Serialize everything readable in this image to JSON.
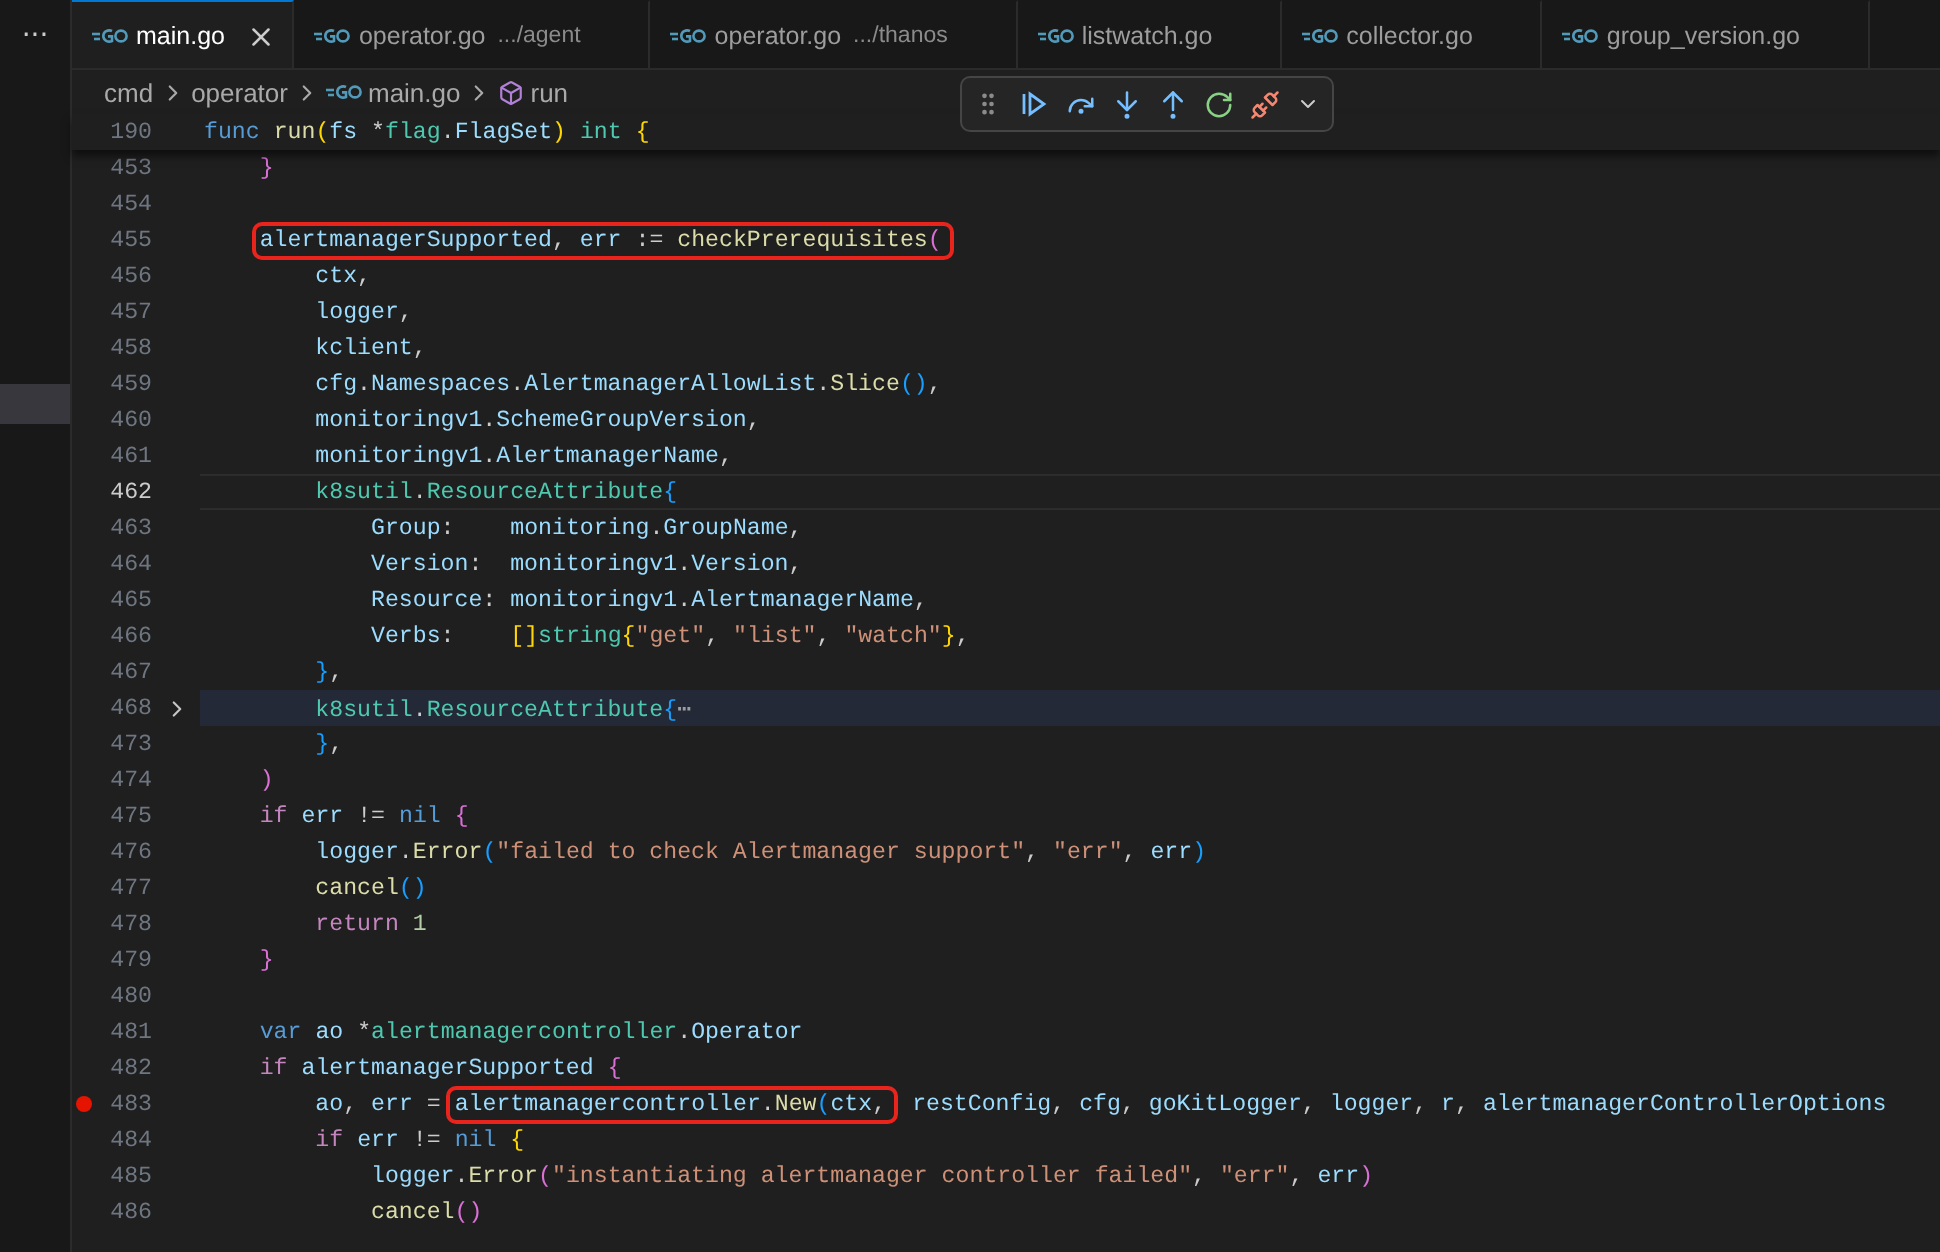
{
  "more_button": "···",
  "tabs": [
    {
      "label": "main.go",
      "selected": true
    },
    {
      "label": "operator.go",
      "detail": ".../agent",
      "selected": false
    },
    {
      "label": "operator.go",
      "detail": ".../thanos",
      "selected": false
    },
    {
      "label": "listwatch.go",
      "selected": false
    },
    {
      "label": "collector.go",
      "selected": false
    },
    {
      "label": "group_version.go",
      "selected": false
    }
  ],
  "breadcrumb": [
    {
      "label": "cmd",
      "kind": "folder"
    },
    {
      "label": "operator",
      "kind": "folder"
    },
    {
      "label": "main.go",
      "kind": "file"
    },
    {
      "label": "run",
      "kind": "symbol"
    }
  ],
  "sticky_line": {
    "number": "190",
    "code": "func run(fs *flag.FlagSet) int {"
  },
  "lines": [
    {
      "number": "453",
      "current": false,
      "breakpoint": false,
      "folded": false,
      "code": "    }"
    },
    {
      "number": "454",
      "current": false,
      "breakpoint": false,
      "folded": false
    },
    {
      "number": "455",
      "current": false,
      "breakpoint": false,
      "folded": false,
      "segments": [
        {
          "text": "    alertmanagerSupported, err := checkPrerequisites(",
          "boxed": true
        }
      ]
    },
    {
      "number": "456",
      "current": false,
      "breakpoint": false,
      "folded": false,
      "code": "        ctx,"
    },
    {
      "number": "457",
      "current": false,
      "breakpoint": false,
      "folded": false,
      "code": "        logger,"
    },
    {
      "number": "458",
      "current": false,
      "breakpoint": false,
      "folded": false,
      "code": "        kclient,"
    },
    {
      "number": "459",
      "current": false,
      "breakpoint": false,
      "folded": false,
      "code": "        cfg.Namespaces.AlertmanagerAllowList.Slice(),"
    },
    {
      "number": "460",
      "current": false,
      "breakpoint": false,
      "folded": false,
      "code": "        monitoringv1.SchemeGroupVersion,"
    },
    {
      "number": "461",
      "current": false,
      "breakpoint": false,
      "folded": false,
      "code": "        monitoringv1.AlertmanagerName,"
    },
    {
      "number": "462",
      "current": true,
      "breakpoint": false,
      "folded": false,
      "code": "        k8sutil.ResourceAttribute{"
    },
    {
      "number": "463",
      "current": false,
      "breakpoint": false,
      "folded": false,
      "code": "            Group:    monitoring.GroupName,"
    },
    {
      "number": "464",
      "current": false,
      "breakpoint": false,
      "folded": false,
      "code": "            Version:  monitoringv1.Version,"
    },
    {
      "number": "465",
      "current": false,
      "breakpoint": false,
      "folded": false,
      "code": "            Resource: monitoringv1.AlertmanagerName,"
    },
    {
      "number": "466",
      "current": false,
      "breakpoint": false,
      "folded": false,
      "code": "            Verbs:    []string{\"get\", \"list\", \"watch\"},"
    },
    {
      "number": "467",
      "current": false,
      "breakpoint": false,
      "folded": false,
      "code": "        },"
    },
    {
      "number": "468",
      "current": false,
      "breakpoint": false,
      "folded": true,
      "code": "        k8sutil.ResourceAttribute{⋯"
    },
    {
      "number": "473",
      "current": false,
      "breakpoint": false,
      "folded": false,
      "code": "        },"
    },
    {
      "number": "474",
      "current": false,
      "breakpoint": false,
      "folded": false,
      "code": "    )"
    },
    {
      "number": "475",
      "current": false,
      "breakpoint": false,
      "folded": false,
      "code": "    if err != nil {"
    },
    {
      "number": "476",
      "current": false,
      "breakpoint": false,
      "folded": false,
      "code": "        logger.Error(\"failed to check Alertmanager support\", \"err\", err)"
    },
    {
      "number": "477",
      "current": false,
      "breakpoint": false,
      "folded": false,
      "code": "        cancel()"
    },
    {
      "number": "478",
      "current": false,
      "breakpoint": false,
      "folded": false,
      "code": "        return 1"
    },
    {
      "number": "479",
      "current": false,
      "breakpoint": false,
      "folded": false,
      "code": "    }"
    },
    {
      "number": "480",
      "current": false,
      "breakpoint": false,
      "folded": false
    },
    {
      "number": "481",
      "current": false,
      "breakpoint": false,
      "folded": false,
      "code": "    var ao *alertmanagercontroller.Operator"
    },
    {
      "number": "482",
      "current": false,
      "breakpoint": false,
      "folded": false,
      "code": "    if alertmanagerSupported {"
    },
    {
      "number": "483",
      "current": false,
      "breakpoint": true,
      "folded": false,
      "segments": [
        {
          "text": "        ao, err =",
          "boxed": false
        },
        {
          "text": "alertmanagercontroller.New(ctx,",
          "boxed": true
        },
        {
          "text": "restConfig, cfg, goKitLogger, logger, r, alertmanagerControllerOptions",
          "boxed": false
        }
      ]
    },
    {
      "number": "484",
      "current": false,
      "breakpoint": false,
      "folded": false,
      "code": "        if err != nil {"
    },
    {
      "number": "485",
      "current": false,
      "breakpoint": false,
      "folded": false,
      "code": "            logger.Error(\"instantiating alertmanager controller failed\", \"err\", err)"
    },
    {
      "number": "486",
      "current": false,
      "breakpoint": false,
      "folded": false,
      "code": "            cancel()"
    }
  ]
}
